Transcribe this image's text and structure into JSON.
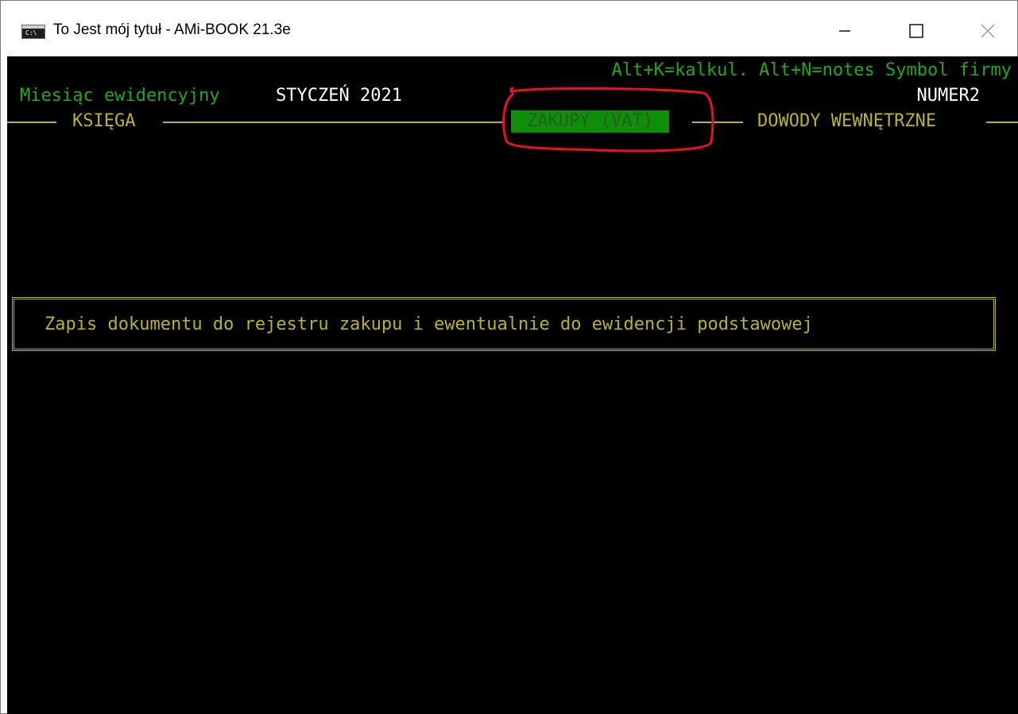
{
  "window": {
    "title": "To Jest mój tytuł - AMi-BOOK 21.3e",
    "icon": "console-window-icon"
  },
  "header": {
    "hotkeys": "Alt+K=kalkul. Alt+N=notes Symbol firmy",
    "month_label": "Miesiąc ewidencyjny",
    "month_value": "STYCZEŃ 2021",
    "company_symbol": "NUMER2"
  },
  "tabs": [
    {
      "label": "KSIĘGA",
      "selected": false
    },
    {
      "label": "ZAKUPY (VAT)",
      "selected": true
    },
    {
      "label": "DOWODY WEWNĘTRZNE",
      "selected": false
    }
  ],
  "message": {
    "text": "Zapis dokumentu do rejestru zakupu i ewentualnie do ewidencji podstawowej"
  },
  "colors": {
    "terminal_bg": "#000000",
    "green_text": "#22a71f",
    "yellow_text": "#b9b32c",
    "selected_tab_bg": "#0d8f0a",
    "annotation_red": "#e8141c"
  }
}
